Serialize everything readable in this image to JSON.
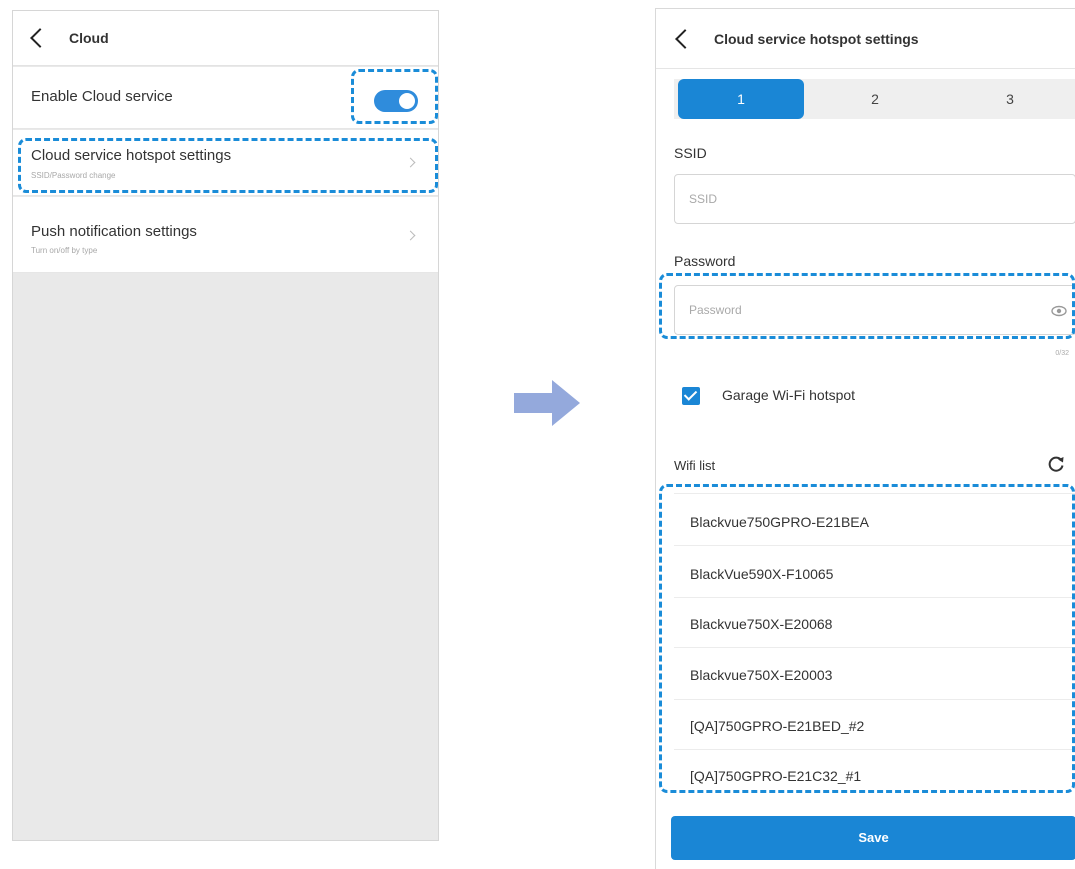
{
  "left_screen": {
    "header": {
      "title": "Cloud"
    },
    "enable_cloud": {
      "label": "Enable Cloud service",
      "toggle_on": true
    },
    "hotspot_settings": {
      "title": "Cloud service hotspot settings",
      "subtitle": "SSID/Password change"
    },
    "push_settings": {
      "title": "Push notification settings",
      "subtitle": "Turn on/off by type"
    }
  },
  "right_screen": {
    "header": {
      "title": "Cloud service hotspot settings"
    },
    "tabs": [
      {
        "label": "1",
        "active": true
      },
      {
        "label": "2",
        "active": false
      },
      {
        "label": "3",
        "active": false
      }
    ],
    "ssid": {
      "label": "SSID",
      "placeholder": "SSID"
    },
    "password": {
      "label": "Password",
      "placeholder": "Password",
      "counter": "0/32"
    },
    "garage_hotspot": {
      "label": "Garage Wi-Fi hotspot",
      "checked": true
    },
    "wifi_list": {
      "label": "Wifi list",
      "items": [
        "Blackvue750GPRO-E21BEA",
        "BlackVue590X-F10065",
        "Blackvue750X-E20068",
        "Blackvue750X-E20003",
        "[QA]750GPRO-E21BED_#2",
        "[QA]750GPRO-E21C32_#1"
      ]
    },
    "save_label": "Save"
  },
  "colors": {
    "accent": "#1a86d5",
    "highlight_dash": "#1a8cd8",
    "arrow": "#94a9dc",
    "background_gray": "#e9e9e9"
  }
}
